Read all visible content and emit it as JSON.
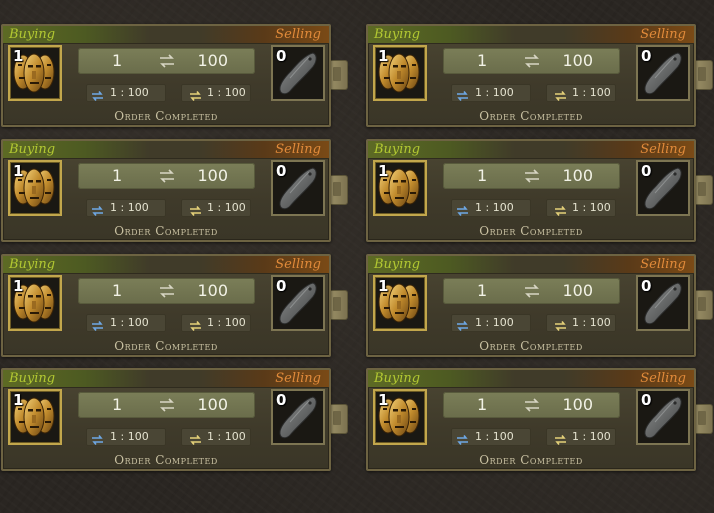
{
  "colors": {
    "buying_label": "#b2c832",
    "selling_label": "#e08a3a",
    "buy_slot_border": "#c2a74c",
    "status_text": "#c9c1a2"
  },
  "orders": [
    {
      "buying_label": "Buying",
      "selling_label": "Selling",
      "buy_item": {
        "icon": "gold-masks-icon",
        "quantity": "1"
      },
      "sell_item": {
        "icon": "grey-stone-shard-icon",
        "quantity": "0"
      },
      "buy_amount": "1",
      "sell_amount": "100",
      "buy_ratio": "1 : 100",
      "sell_ratio": "1 : 100",
      "status": "Order Completed"
    },
    {
      "buying_label": "Buying",
      "selling_label": "Selling",
      "buy_item": {
        "icon": "gold-masks-icon",
        "quantity": "1"
      },
      "sell_item": {
        "icon": "grey-stone-shard-icon",
        "quantity": "0"
      },
      "buy_amount": "1",
      "sell_amount": "100",
      "buy_ratio": "1 : 100",
      "sell_ratio": "1 : 100",
      "status": "Order Completed"
    },
    {
      "buying_label": "Buying",
      "selling_label": "Selling",
      "buy_item": {
        "icon": "gold-masks-icon",
        "quantity": "1"
      },
      "sell_item": {
        "icon": "grey-stone-shard-icon",
        "quantity": "0"
      },
      "buy_amount": "1",
      "sell_amount": "100",
      "buy_ratio": "1 : 100",
      "sell_ratio": "1 : 100",
      "status": "Order Completed"
    },
    {
      "buying_label": "Buying",
      "selling_label": "Selling",
      "buy_item": {
        "icon": "gold-masks-icon",
        "quantity": "1"
      },
      "sell_item": {
        "icon": "grey-stone-shard-icon",
        "quantity": "0"
      },
      "buy_amount": "1",
      "sell_amount": "100",
      "buy_ratio": "1 : 100",
      "sell_ratio": "1 : 100",
      "status": "Order Completed"
    },
    {
      "buying_label": "Buying",
      "selling_label": "Selling",
      "buy_item": {
        "icon": "gold-masks-icon",
        "quantity": "1"
      },
      "sell_item": {
        "icon": "grey-stone-shard-icon",
        "quantity": "0"
      },
      "buy_amount": "1",
      "sell_amount": "100",
      "buy_ratio": "1 : 100",
      "sell_ratio": "1 : 100",
      "status": "Order Completed"
    },
    {
      "buying_label": "Buying",
      "selling_label": "Selling",
      "buy_item": {
        "icon": "gold-masks-icon",
        "quantity": "1"
      },
      "sell_item": {
        "icon": "grey-stone-shard-icon",
        "quantity": "0"
      },
      "buy_amount": "1",
      "sell_amount": "100",
      "buy_ratio": "1 : 100",
      "sell_ratio": "1 : 100",
      "status": "Order Completed"
    },
    {
      "buying_label": "Buying",
      "selling_label": "Selling",
      "buy_item": {
        "icon": "gold-masks-icon",
        "quantity": "1"
      },
      "sell_item": {
        "icon": "grey-stone-shard-icon",
        "quantity": "0"
      },
      "buy_amount": "1",
      "sell_amount": "100",
      "buy_ratio": "1 : 100",
      "sell_ratio": "1 : 100",
      "status": "Order Completed"
    },
    {
      "buying_label": "Buying",
      "selling_label": "Selling",
      "buy_item": {
        "icon": "gold-masks-icon",
        "quantity": "1"
      },
      "sell_item": {
        "icon": "grey-stone-shard-icon",
        "quantity": "0"
      },
      "buy_amount": "1",
      "sell_amount": "100",
      "buy_ratio": "1 : 100",
      "sell_ratio": "1 : 100",
      "status": "Order Completed"
    }
  ]
}
